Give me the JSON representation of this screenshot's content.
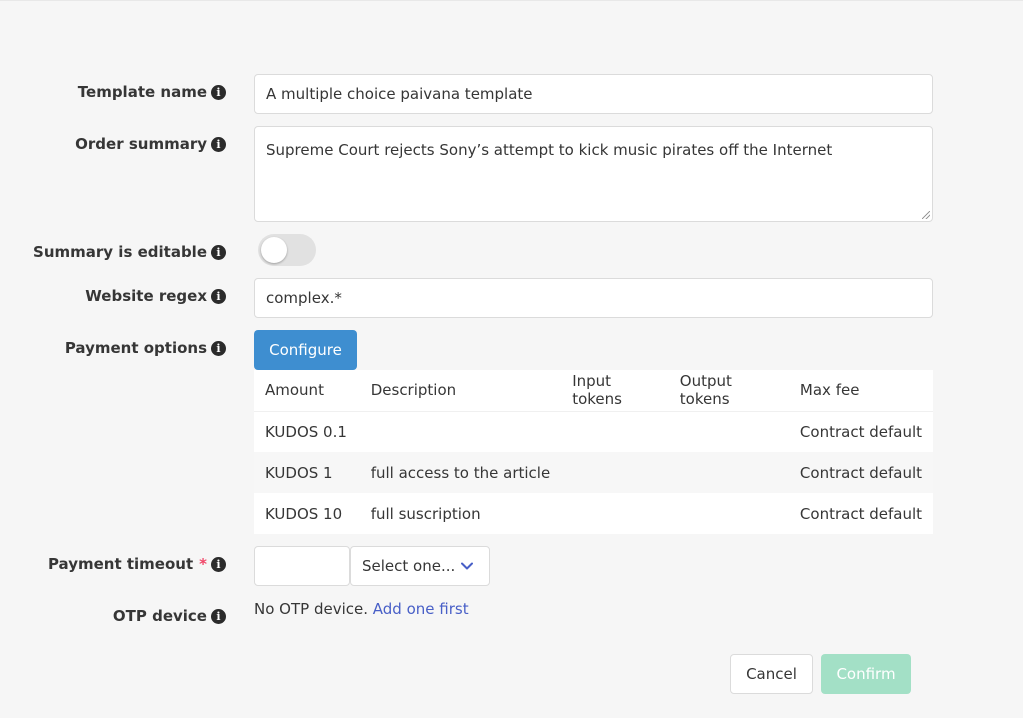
{
  "form": {
    "template_name": {
      "label": "Template name",
      "value": "A multiple choice paivana template"
    },
    "order_summary": {
      "label": "Order summary",
      "value": "Supreme Court rejects Sony’s attempt to kick music pirates off the Internet"
    },
    "summary_editable": {
      "label": "Summary is editable",
      "checked": false
    },
    "website_regex": {
      "label": "Website regex",
      "value": "complex.*"
    },
    "payment_options": {
      "label": "Payment options",
      "configure_label": "Configure",
      "columns": [
        "Amount",
        "Description",
        "Input tokens",
        "Output tokens",
        "Max fee"
      ],
      "rows": [
        [
          "KUDOS 0.1",
          "",
          "",
          "",
          "Contract default"
        ],
        [
          "KUDOS 1",
          "full access to the article",
          "",
          "",
          "Contract default"
        ],
        [
          "KUDOS 10",
          "full suscription",
          "",
          "",
          "Contract default"
        ]
      ]
    },
    "payment_timeout": {
      "label": "Payment timeout",
      "required_mark": "*",
      "value": "",
      "select_label": "Select one..."
    },
    "otp_device": {
      "label": "OTP device",
      "text": "No OTP device.",
      "link": "Add one first"
    }
  },
  "actions": {
    "cancel": "Cancel",
    "confirm": "Confirm"
  },
  "colors": {
    "primary": "#3e8ed0",
    "confirm_disabled": "#a3e0c6",
    "link": "#485fc7",
    "required": "#f14668"
  },
  "icons": {
    "info": "info-icon",
    "select": "chevron-down-icon"
  },
  "info_glyph": "i"
}
